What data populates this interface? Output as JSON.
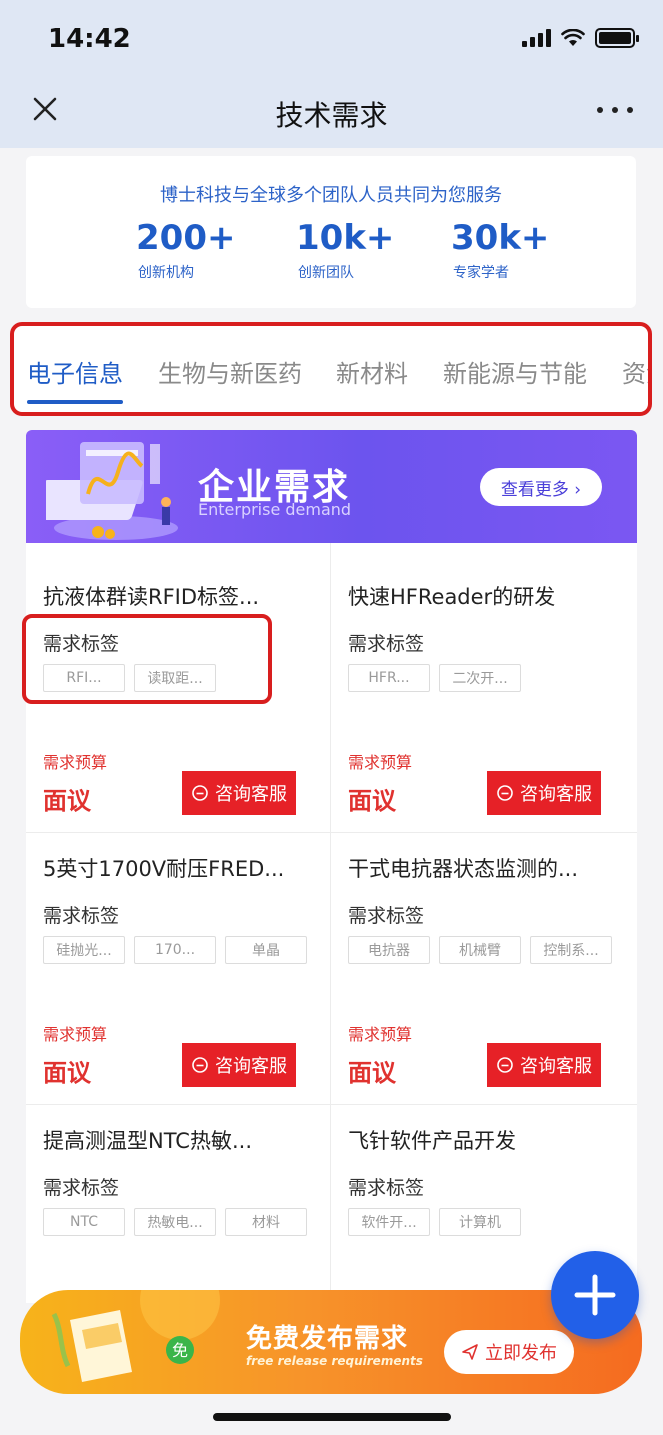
{
  "status_bar": {
    "time": "14:42"
  },
  "header": {
    "title": "技术需求"
  },
  "stats": {
    "subtitle": "博士科技与全球多个团队人员共同为您服务",
    "items": [
      {
        "value": "200+",
        "label": "创新机构"
      },
      {
        "value": "10k+",
        "label": "创新团队"
      },
      {
        "value": "30k+",
        "label": "专家学者"
      }
    ]
  },
  "tabs": [
    "电子信息",
    "生物与新医药",
    "新材料",
    "新能源与节能",
    "资源"
  ],
  "banner": {
    "title": "企业需求",
    "subtitle": "Enterprise demand",
    "button": "查看更多 ›"
  },
  "cards": [
    {
      "title": "抗液体群读RFID标签...",
      "tag_label": "需求标签",
      "tags": [
        "RFI...",
        "读取距..."
      ],
      "budget_label": "需求预算",
      "budget": "面议",
      "consult": "咨询客服"
    },
    {
      "title": "快速HFReader的研发",
      "tag_label": "需求标签",
      "tags": [
        "HFR...",
        "二次开..."
      ],
      "budget_label": "需求预算",
      "budget": "面议",
      "consult": "咨询客服"
    },
    {
      "title": "5英寸1700V耐压FRED...",
      "tag_label": "需求标签",
      "tags": [
        "硅抛光...",
        "170...",
        "单晶"
      ],
      "budget_label": "需求预算",
      "budget": "面议",
      "consult": "咨询客服"
    },
    {
      "title": "干式电抗器状态监测的...",
      "tag_label": "需求标签",
      "tags": [
        "电抗器",
        "机械臂",
        "控制系..."
      ],
      "budget_label": "需求预算",
      "budget": "面议",
      "consult": "咨询客服"
    },
    {
      "title": "提高测温型NTC热敏...",
      "tag_label": "需求标签",
      "tags": [
        "NTC",
        "热敏电...",
        "材料"
      ]
    },
    {
      "title": "飞针软件产品开发",
      "tag_label": "需求标签",
      "tags": [
        "软件开...",
        "计算机"
      ]
    }
  ],
  "release_banner": {
    "badge": "免",
    "title": "免费发布需求",
    "subtitle": "free release requirements",
    "button": "立即发布"
  },
  "colors": {
    "brand_blue": "#1f5cc6",
    "budget_red": "#e0322f",
    "consult_red": "#e62127"
  }
}
